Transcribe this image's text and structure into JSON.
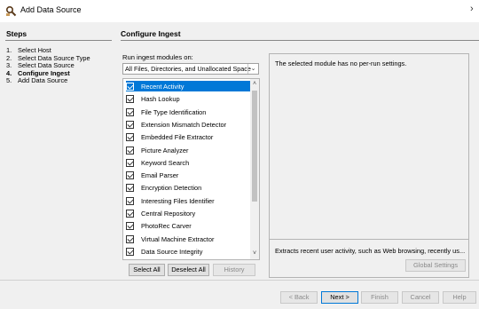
{
  "window": {
    "title": "Add Data Source",
    "close_glyph": "›",
    "icon": "magnifier-app-icon"
  },
  "steps": {
    "title": "Steps",
    "items": [
      {
        "number": "1.",
        "label": "Select Host"
      },
      {
        "number": "2.",
        "label": "Select Data Source Type"
      },
      {
        "number": "3.",
        "label": "Select Data Source"
      },
      {
        "number": "4.",
        "label": "Configure Ingest"
      },
      {
        "number": "5.",
        "label": "Add Data Source"
      }
    ],
    "active_index": 3
  },
  "configure": {
    "title": "Configure Ingest",
    "run_label": "Run ingest modules on:",
    "scope_value": "All Files, Directories, and Unallocated Space",
    "modules": [
      {
        "label": "Recent Activity",
        "checked": true,
        "selected": true
      },
      {
        "label": "Hash Lookup",
        "checked": true
      },
      {
        "label": "File Type Identification",
        "checked": true
      },
      {
        "label": "Extension Mismatch Detector",
        "checked": true
      },
      {
        "label": "Embedded File Extractor",
        "checked": true
      },
      {
        "label": "Picture Analyzer",
        "checked": true
      },
      {
        "label": "Keyword Search",
        "checked": true
      },
      {
        "label": "Email Parser",
        "checked": true
      },
      {
        "label": "Encryption Detection",
        "checked": true
      },
      {
        "label": "Interesting Files Identifier",
        "checked": true
      },
      {
        "label": "Central Repository",
        "checked": true
      },
      {
        "label": "PhotoRec Carver",
        "checked": true
      },
      {
        "label": "Virtual Machine Extractor",
        "checked": true
      },
      {
        "label": "Data Source Integrity",
        "checked": true
      }
    ],
    "buttons": {
      "select_all": "Select All",
      "deselect_all": "Deselect All",
      "history": "History"
    },
    "settings_message": "The selected module has no per-run settings.",
    "module_description": "Extracts recent user activity, such as Web browsing, recently us...",
    "global_settings": "Global Settings"
  },
  "footer": {
    "back": "< Back",
    "next": "Next >",
    "finish": "Finish",
    "cancel": "Cancel",
    "help": "Help"
  },
  "colors": {
    "selection": "#0078d7",
    "panel": "#f0f0f0"
  }
}
